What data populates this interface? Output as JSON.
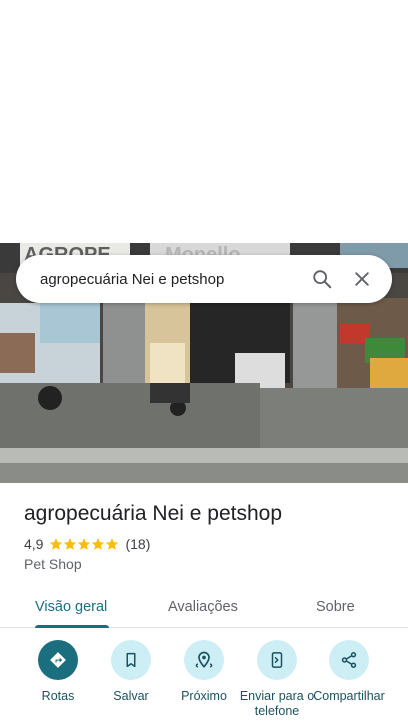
{
  "search": {
    "query": "agropecuária Nei e petshop",
    "search_icon": "search-icon",
    "close_icon": "close-icon"
  },
  "photo": {
    "sign_text_left": "AGROPE",
    "sign_text_right": "Monello"
  },
  "place": {
    "name": "agropecuária Nei e petshop",
    "rating": "4,9",
    "stars": 5,
    "review_count": "(18)",
    "category": "Pet Shop"
  },
  "tabs": [
    {
      "label": "Visão geral",
      "active": true
    },
    {
      "label": "Avaliações",
      "active": false
    },
    {
      "label": "Sobre",
      "active": false
    }
  ],
  "actions": [
    {
      "label": "Rotas",
      "icon": "directions-icon"
    },
    {
      "label": "Salvar",
      "icon": "bookmark-icon"
    },
    {
      "label": "Próximo",
      "icon": "nearby-icon"
    },
    {
      "label": "Enviar para o telefone",
      "icon": "send-to-phone-icon"
    },
    {
      "label": "Compartilhar",
      "icon": "share-icon"
    }
  ],
  "colors": {
    "accent": "#1a6e7e",
    "action_bg": "#cdeef5",
    "star": "#fbbc04"
  }
}
